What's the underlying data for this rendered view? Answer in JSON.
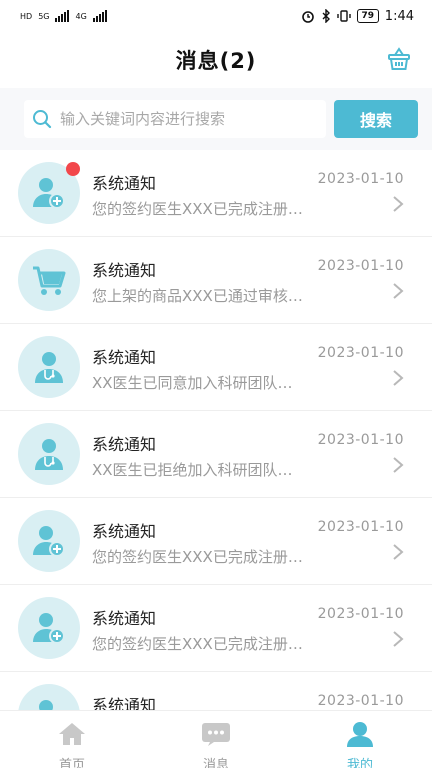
{
  "status_bar": {
    "left_labels": [
      "HD",
      "5G",
      "4G"
    ],
    "time": "1:44",
    "battery": "79"
  },
  "header": {
    "title": "消息(2)"
  },
  "search": {
    "placeholder": "输入关键词内容进行搜索",
    "button_label": "搜索"
  },
  "messages": [
    {
      "title": "系统通知",
      "date": "2023-01-10",
      "preview": "您的签约医生XXX已完成注册…",
      "icon": "user-add-icon",
      "unread": true
    },
    {
      "title": "系统通知",
      "date": "2023-01-10",
      "preview": "您上架的商品XXX已通过审核…",
      "icon": "cart-icon",
      "unread": false
    },
    {
      "title": "系统通知",
      "date": "2023-01-10",
      "preview": "XX医生已同意加入科研团队…",
      "icon": "doctor-icon",
      "unread": false
    },
    {
      "title": "系统通知",
      "date": "2023-01-10",
      "preview": "XX医生已拒绝加入科研团队…",
      "icon": "doctor-icon",
      "unread": false
    },
    {
      "title": "系统通知",
      "date": "2023-01-10",
      "preview": "您的签约医生XXX已完成注册…",
      "icon": "user-add-icon",
      "unread": false
    },
    {
      "title": "系统通知",
      "date": "2023-01-10",
      "preview": "您的签约医生XXX已完成注册…",
      "icon": "user-add-icon",
      "unread": false
    },
    {
      "title": "系统通知",
      "date": "2023-01-10",
      "preview": "",
      "icon": "user-add-icon",
      "unread": false
    }
  ],
  "tabs": [
    {
      "label": "首页",
      "icon": "home-icon",
      "active": false
    },
    {
      "label": "消息",
      "icon": "message-icon",
      "active": false
    },
    {
      "label": "我的",
      "icon": "profile-icon",
      "active": true
    }
  ],
  "colors": {
    "accent": "#4dbad3",
    "avatar_bg": "#d9eff3",
    "icon_fill": "#5fc3d5",
    "unread_dot": "#f2474b"
  }
}
